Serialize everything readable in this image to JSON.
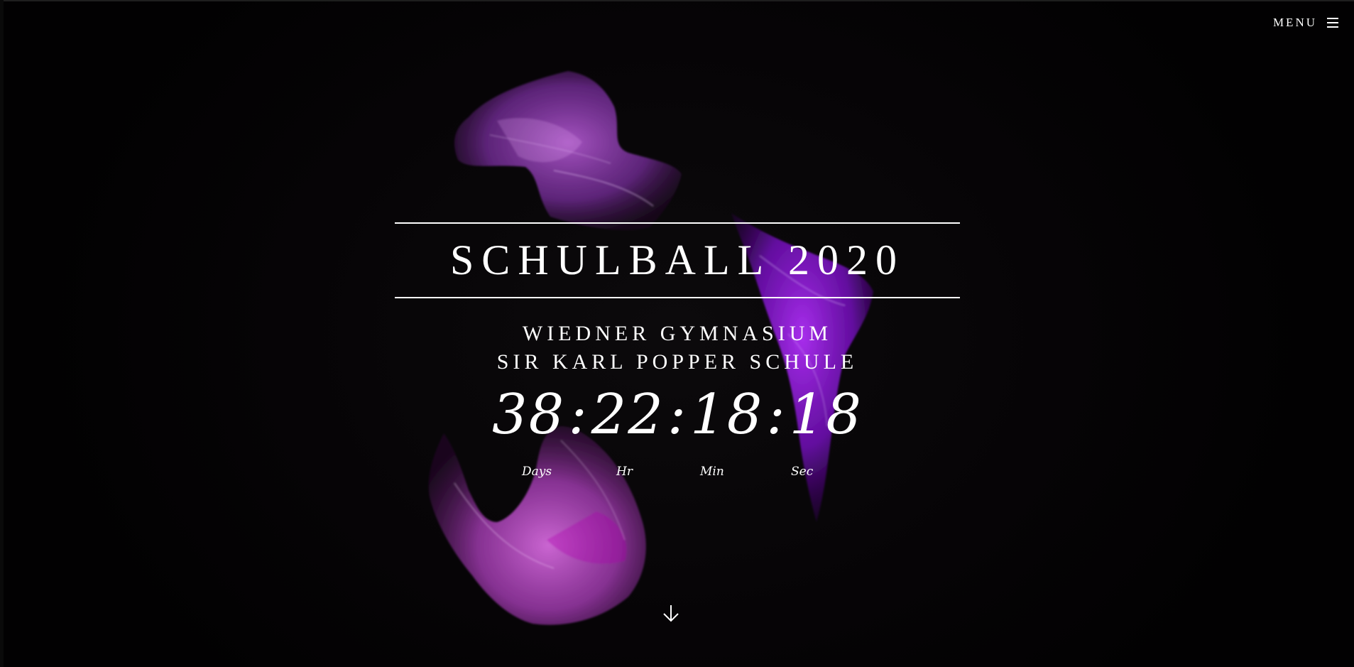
{
  "menu": {
    "label": "MENU",
    "icon": "hamburger-menu-icon"
  },
  "hero": {
    "title": "SCHULBALL 2020",
    "subtitle_line1": "WIEDNER GYMNASIUM",
    "subtitle_line2": "SIR KARL POPPER SCHULE"
  },
  "countdown": {
    "days": "38",
    "hours": "22",
    "minutes": "18",
    "seconds": "18",
    "separator": ":",
    "labels": {
      "days": "Days",
      "hours": "Hr",
      "minutes": "Min",
      "seconds": "Sec"
    }
  },
  "scroll": {
    "icon": "arrow-down-icon"
  },
  "colors": {
    "background": "#050305",
    "text": "#ffffff",
    "accent_purple": "#a020f0",
    "accent_pink": "#d060d8"
  }
}
